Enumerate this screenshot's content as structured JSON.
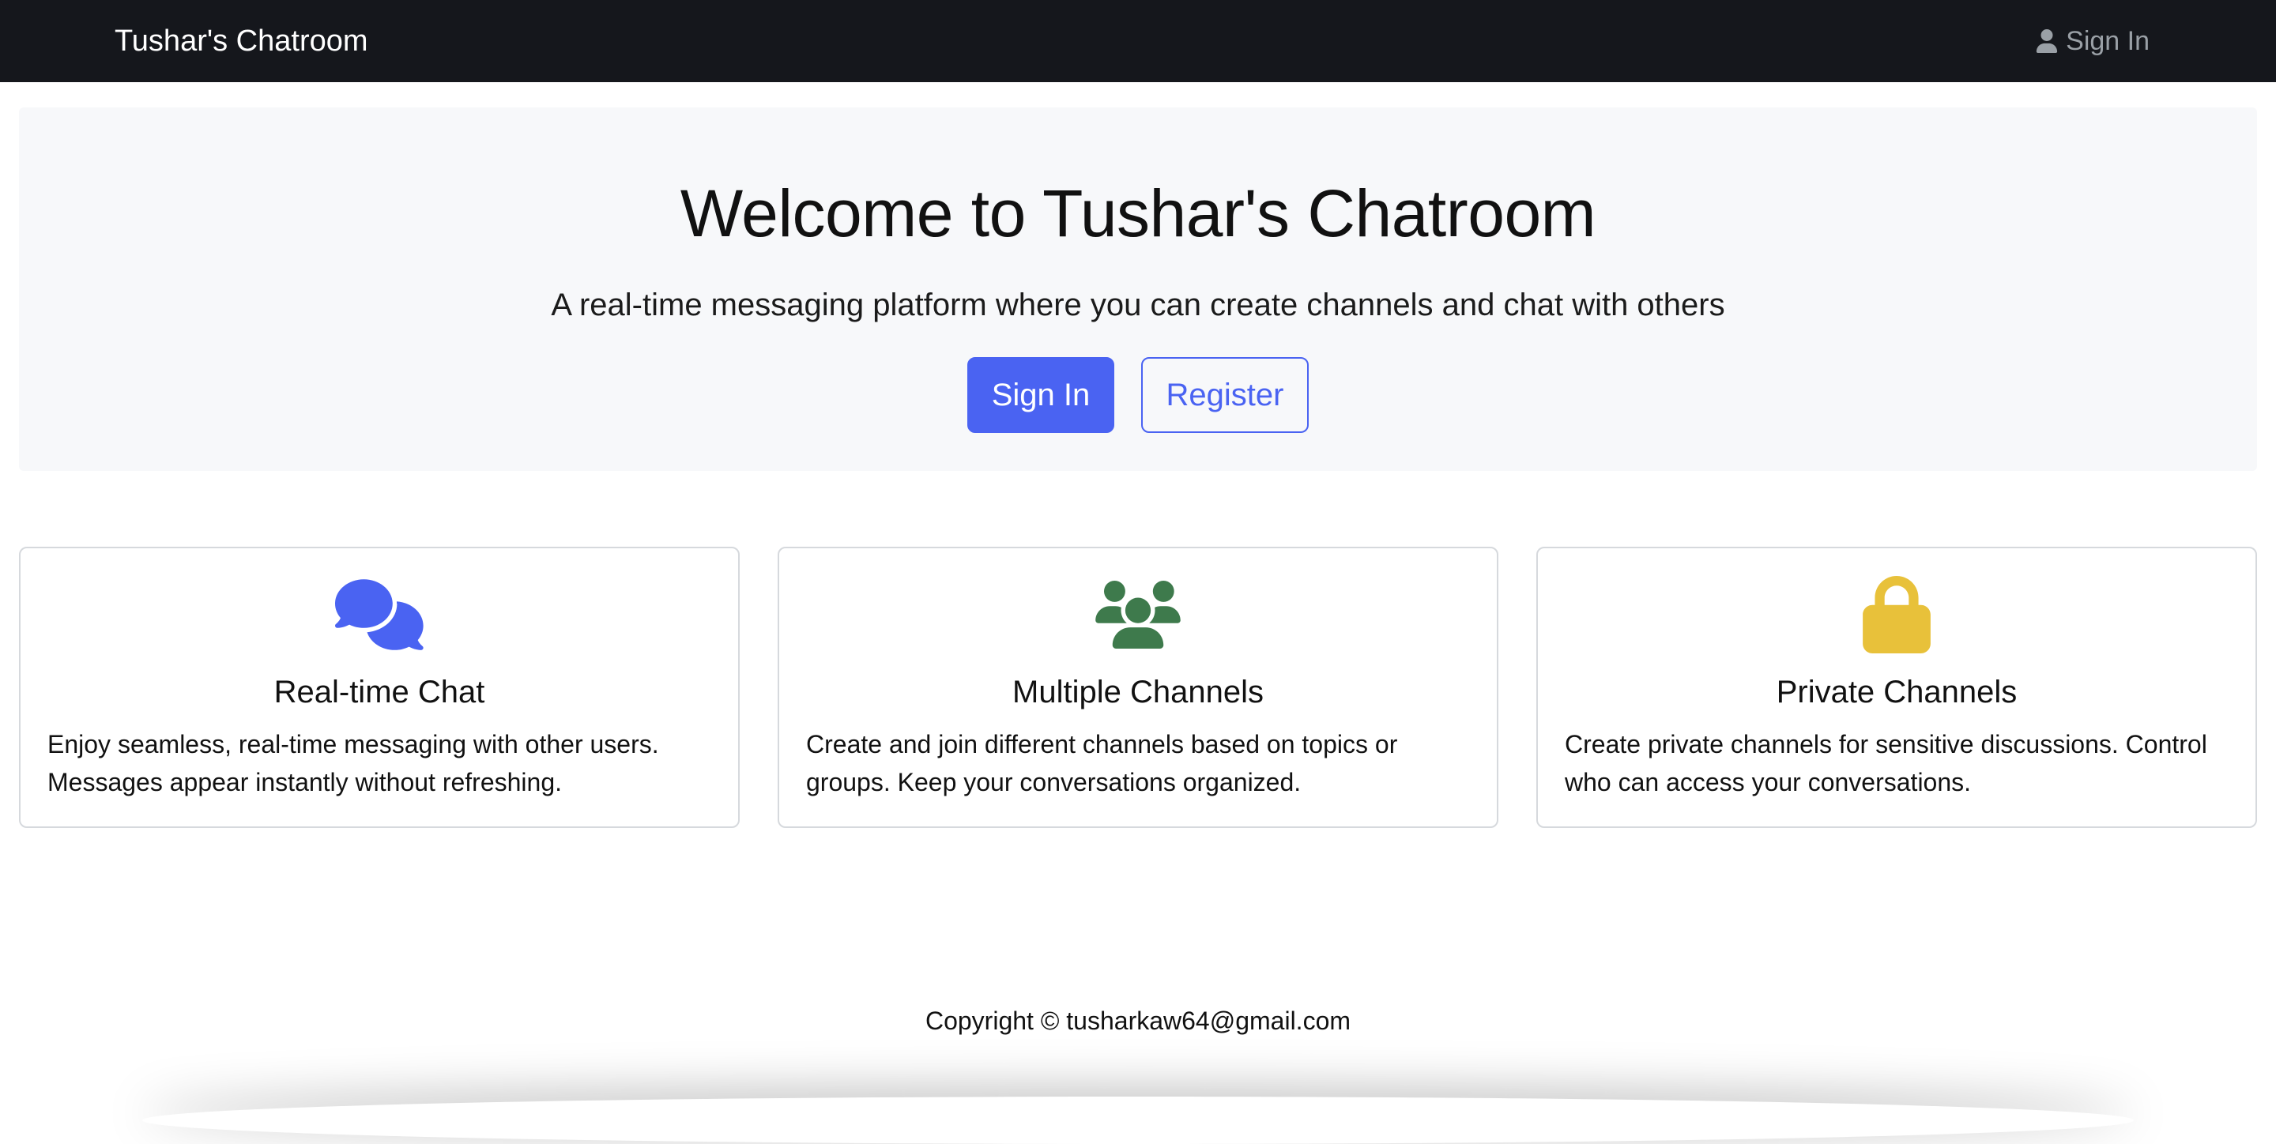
{
  "navbar": {
    "brand": "Tushar's Chatroom",
    "signin_label": "Sign In",
    "signin_icon": "user-icon"
  },
  "hero": {
    "title": "Welcome to Tushar's Chatroom",
    "subtitle": "A real-time messaging platform where you can create channels and chat with others",
    "signin_button": "Sign In",
    "register_button": "Register"
  },
  "features": [
    {
      "icon": "comments-icon",
      "icon_color": "#4a63f2",
      "title": "Real-time Chat",
      "text": "Enjoy seamless, real-time messaging with other users. Messages appear instantly without refreshing."
    },
    {
      "icon": "users-icon",
      "icon_color": "#3e7a4c",
      "title": "Multiple Channels",
      "text": "Create and join different channels based on topics or groups. Keep your conversations organized."
    },
    {
      "icon": "lock-icon",
      "icon_color": "#e8c13a",
      "title": "Private Channels",
      "text": "Create private channels for sensitive discussions. Control who can access your conversations."
    }
  ],
  "footer": {
    "copyright": "Copyright © tusharkaw64@gmail.com"
  },
  "colors": {
    "navbar_bg": "#15171c",
    "primary": "#4a63f2",
    "hero_bg": "#f7f8fa"
  }
}
